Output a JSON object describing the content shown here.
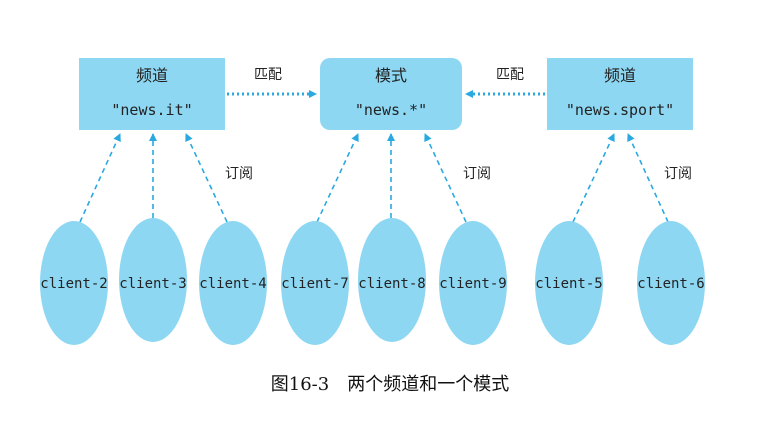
{
  "colors": {
    "node_fill": "#8DD7F3",
    "edge": "#29A9E0",
    "text": "#222222"
  },
  "nodes": {
    "channel_it": {
      "title": "频道",
      "value": "\"news.it\""
    },
    "pattern": {
      "title": "模式",
      "value": "\"news.*\""
    },
    "channel_sport": {
      "title": "频道",
      "value": "\"news.sport\""
    }
  },
  "edge_labels": {
    "match_left": "匹配",
    "match_right": "匹配",
    "subscribe_it": "订阅",
    "subscribe_pattern": "订阅",
    "subscribe_sport": "订阅"
  },
  "clients": [
    "client-2",
    "client-3",
    "client-4",
    "client-7",
    "client-8",
    "client-9",
    "client-5",
    "client-6"
  ],
  "caption": "图16-3　两个频道和一个模式"
}
